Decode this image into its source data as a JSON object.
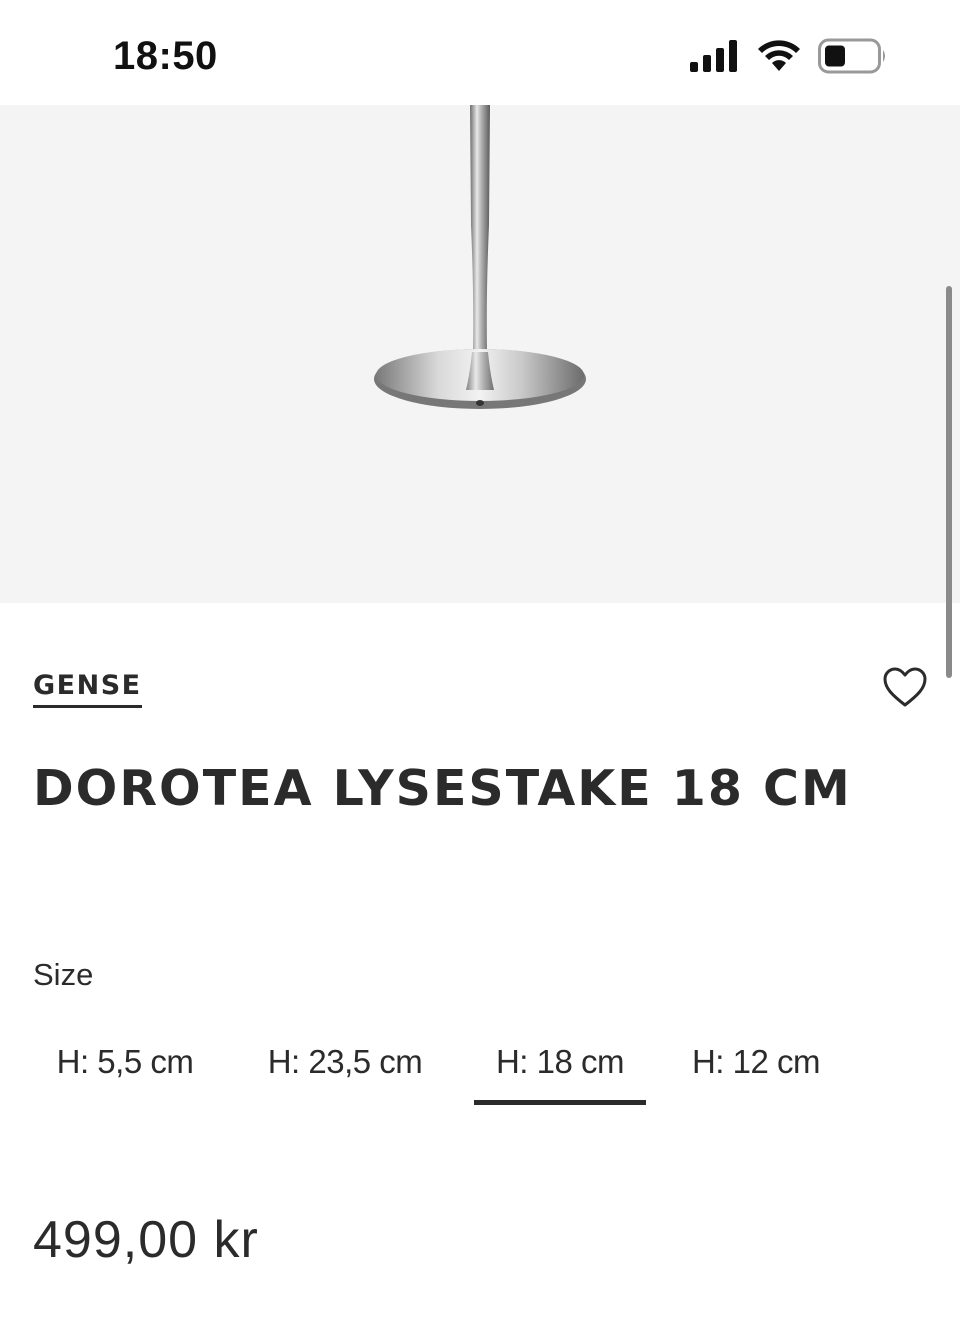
{
  "status_bar": {
    "time": "18:50",
    "icons": [
      "cellular-signal-icon",
      "wifi-icon",
      "battery-icon"
    ]
  },
  "product": {
    "brand": "GENSE",
    "title": "DOROTEA LYSESTAKE 18 CM",
    "size_label": "Size",
    "sizes": [
      "H: 5,5 cm",
      "H: 23,5 cm",
      "H: 18 cm",
      "H: 12 cm"
    ],
    "selected_size": "H: 18 cm",
    "price": "499,00 kr"
  },
  "colors": {
    "text": "#2b2b2b",
    "hero_background": "#f4f4f4"
  },
  "icons": {
    "favorite": "heart-icon"
  }
}
